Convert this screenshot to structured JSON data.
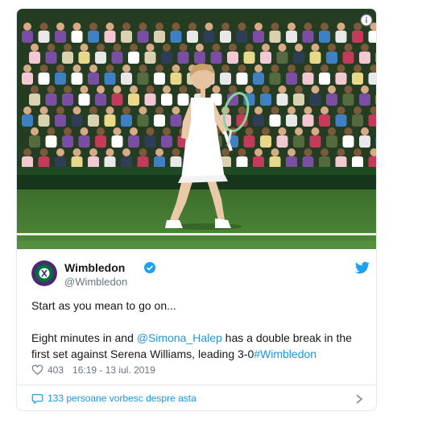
{
  "tweet": {
    "author": {
      "display_name": "Wimbledon",
      "handle": "@Wimbledon",
      "verified": true
    },
    "text": {
      "line1": "Start as you mean to go on...",
      "line2_pre": "Eight minutes in and ",
      "mention": "@Simona_Halep",
      "line2_mid": " has a double break in the first set against Serena Williams, leading 3-0",
      "hashtag": "#Wimbledon"
    },
    "likes": "403",
    "timestamp": "16:19 - 13 iul. 2019",
    "conversation": "133 persoane vorbesc despre asta"
  },
  "icons": {
    "info": "info-icon",
    "verified": "verified-badge-icon",
    "twitter": "twitter-bird-icon",
    "like": "heart-icon",
    "reply": "speech-bubble-icon",
    "chevron": "chevron-right-icon"
  },
  "colors": {
    "link": "#1b95e0",
    "muted": "#657786",
    "border": "#e1e8ed",
    "brand_purple": "#4b2a73",
    "brand_green": "#00703c"
  }
}
